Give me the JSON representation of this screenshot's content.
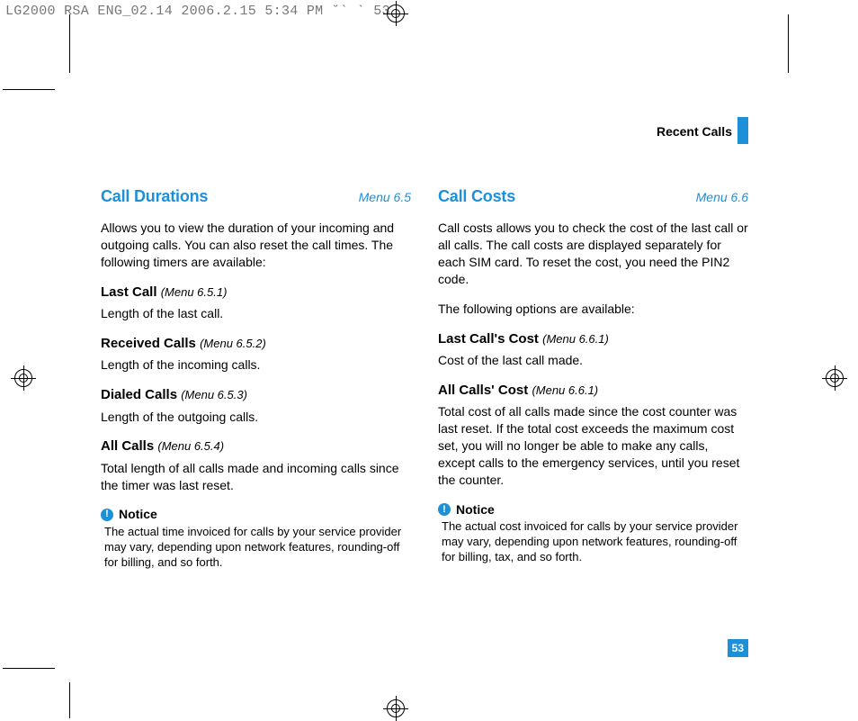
{
  "header_line": "LG2000 RSA ENG_02.14  2006.2.15 5:34 PM  ˘` ` 53",
  "running_head": "Recent Calls",
  "page_number": "53",
  "left": {
    "title": "Call Durations",
    "menu": "Menu 6.5",
    "intro": "Allows you to view the duration of your incoming and outgoing calls. You can also reset the call times. The following timers are available:",
    "items": [
      {
        "name": "Last Call",
        "menu": "(Menu 6.5.1)",
        "desc": "Length of the last call."
      },
      {
        "name": "Received Calls",
        "menu": "(Menu 6.5.2)",
        "desc": "Length of the incoming calls."
      },
      {
        "name": "Dialed Calls",
        "menu": "(Menu 6.5.3)",
        "desc": "Length of the outgoing calls."
      },
      {
        "name": "All Calls",
        "menu": "(Menu 6.5.4)",
        "desc": "Total length of all calls made and incoming calls since the timer was last reset."
      }
    ],
    "notice_label": "Notice",
    "notice_text": "The actual time invoiced for calls by your service provider may vary, depending upon network features, rounding-off for billing, and so forth."
  },
  "right": {
    "title": "Call Costs",
    "menu": "Menu 6.6",
    "intro": "Call costs allows you to check the cost of the last call or all calls. The call costs are displayed separately for each SIM card. To reset the cost, you need the PIN2 code.",
    "intro2": "The following options are available:",
    "items": [
      {
        "name": "Last Call's Cost",
        "menu": "(Menu 6.6.1)",
        "desc": "Cost of the last call made."
      },
      {
        "name": "All Calls' Cost",
        "menu": "(Menu 6.6.1)",
        "desc": "Total cost of all calls made since the cost counter was last reset. If the total cost exceeds the maximum cost set, you will no longer be able to make any calls, except calls to the emergency services, until you reset the counter."
      }
    ],
    "notice_label": "Notice",
    "notice_text": "The actual cost invoiced for calls by your service provider may vary, depending upon network features, rounding-off for billing, tax, and so forth."
  }
}
